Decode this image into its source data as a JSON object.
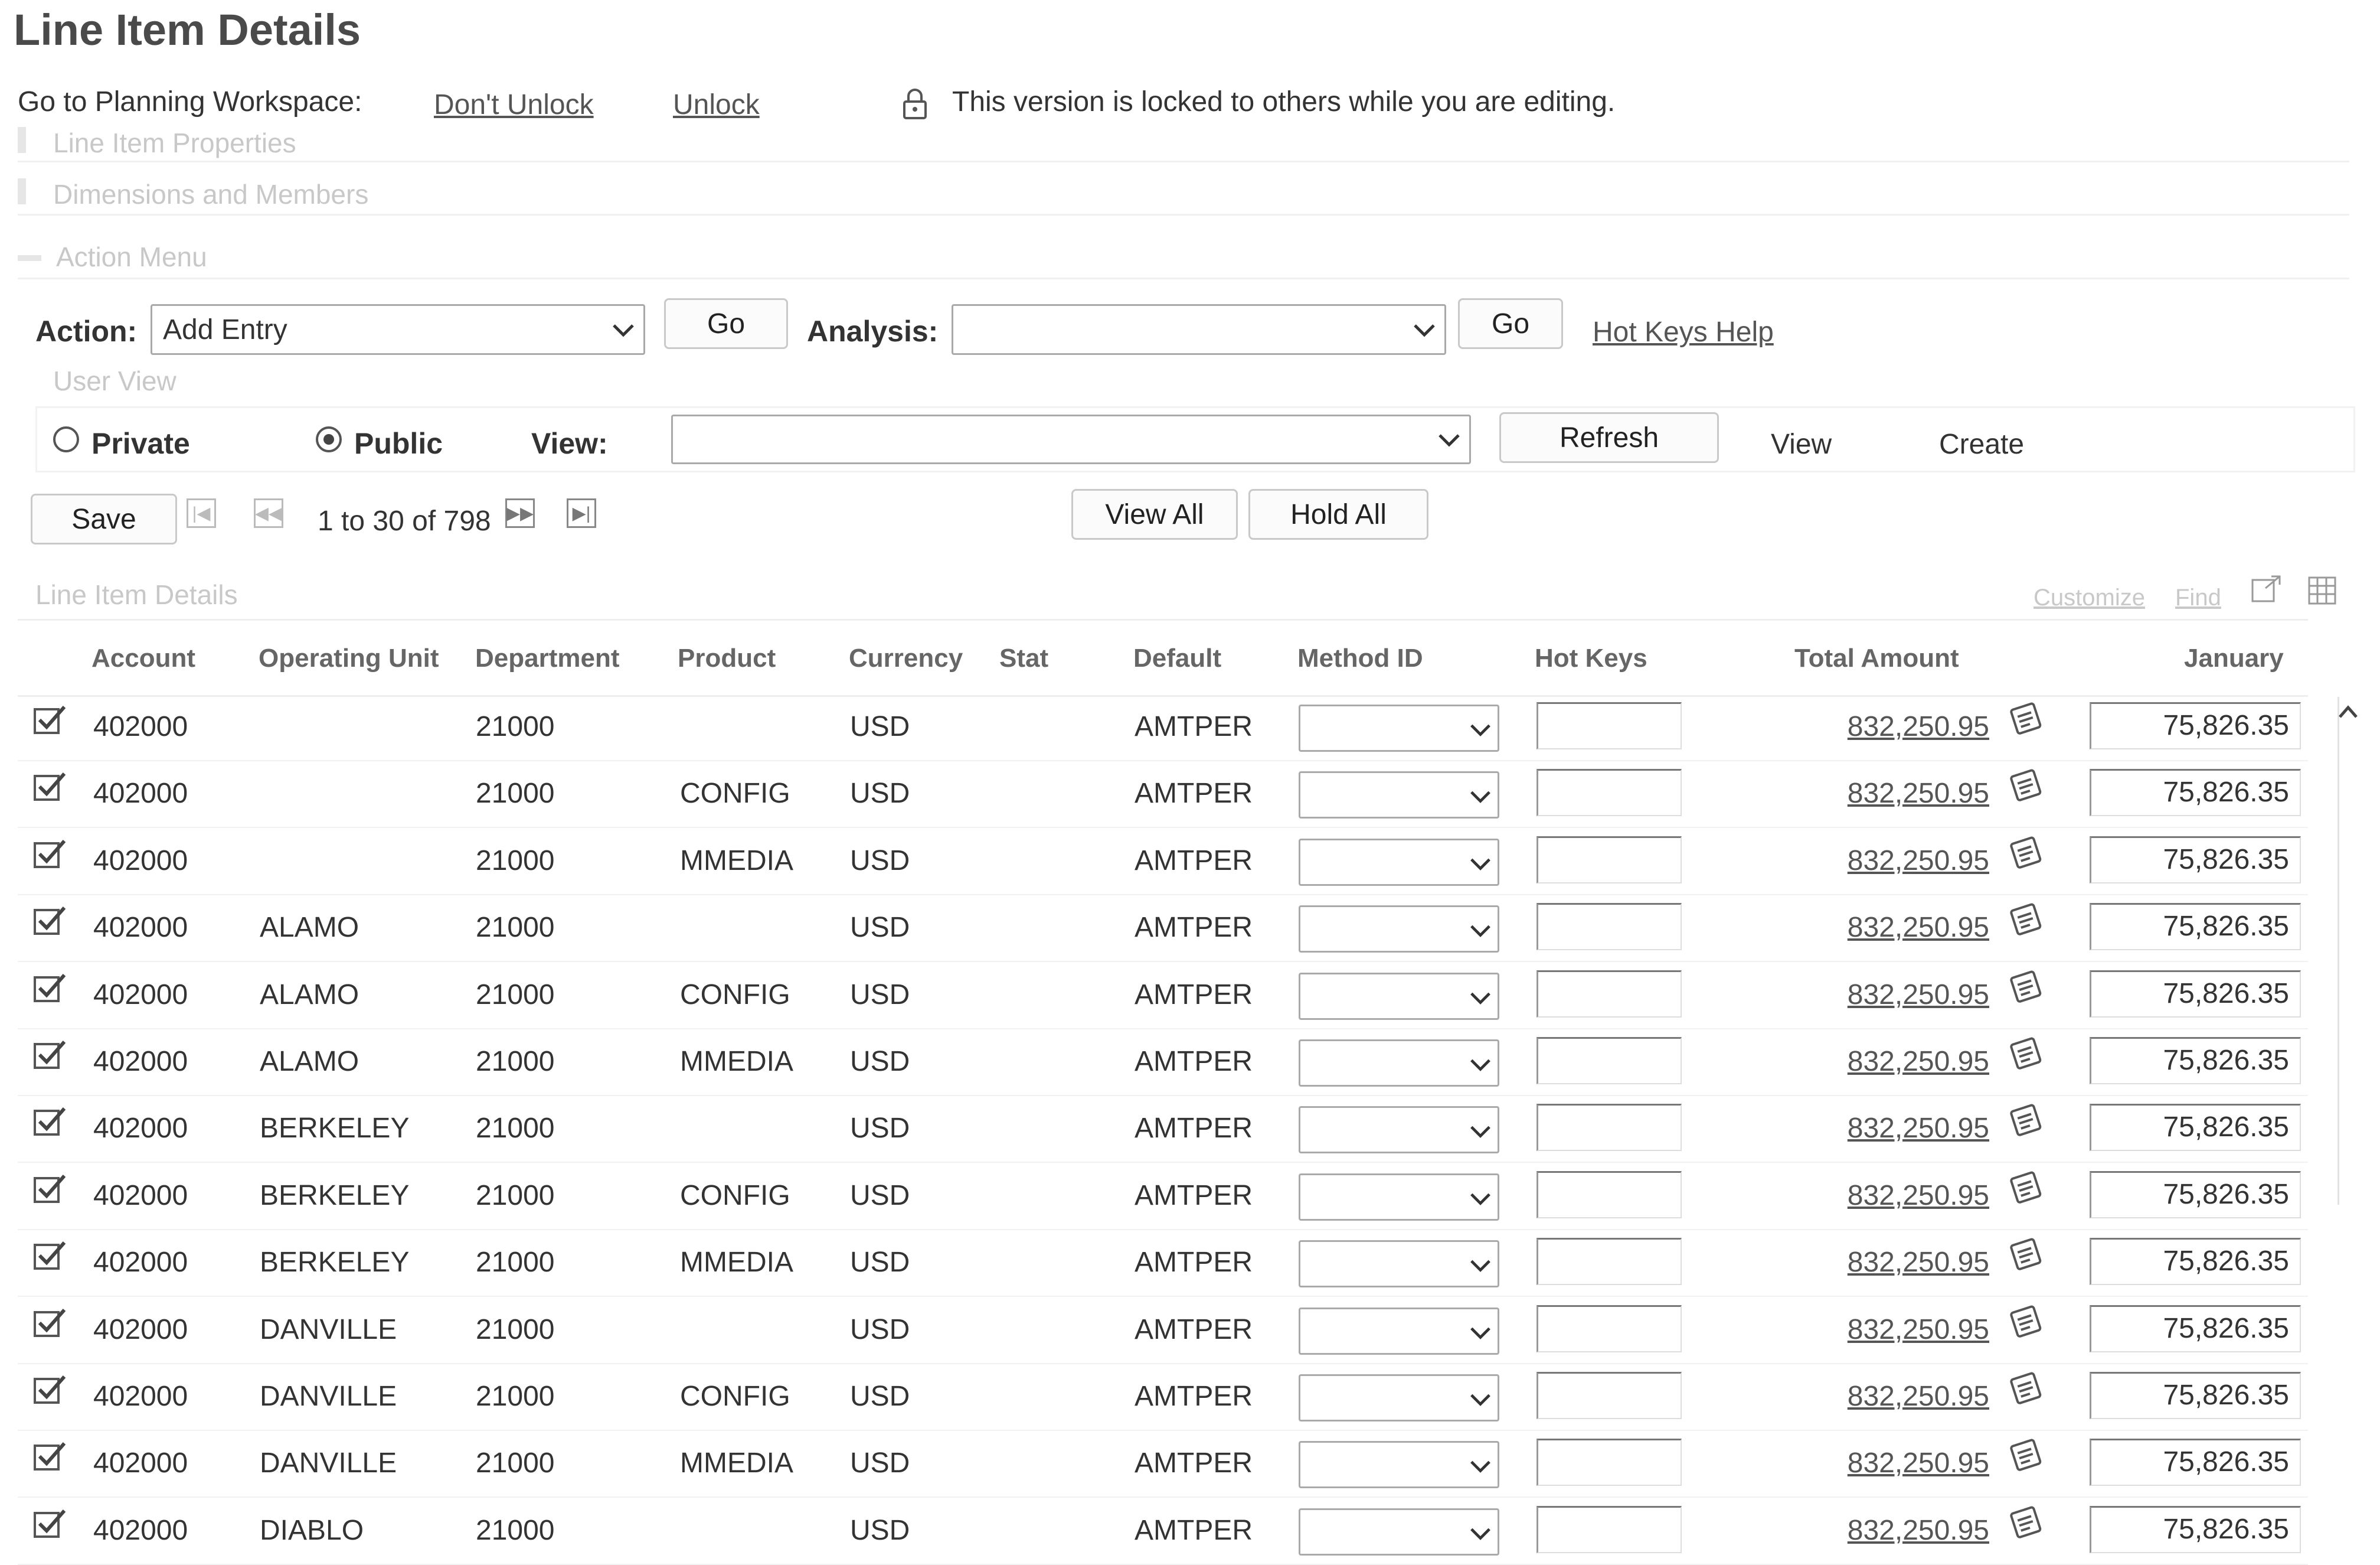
{
  "page_title": "Line Item Details",
  "workspace": {
    "label": "Go to Planning Workspace:",
    "dont_unlock": "Don't Unlock",
    "unlock": "Unlock",
    "lock_message": "This version is locked to others while you are editing."
  },
  "sections": {
    "line_item_properties": "Line Item Properties",
    "dimensions_members": "Dimensions and Members",
    "action_menu": "Action Menu",
    "user_view": "User View",
    "grid_title": "Line Item Details"
  },
  "action_menu": {
    "action_label": "Action:",
    "action_value": "Add Entry",
    "go_label": "Go",
    "analysis_label": "Analysis:",
    "analysis_value": "",
    "hotkeys_help": "Hot Keys Help"
  },
  "user_view": {
    "private_label": "Private",
    "public_label": "Public",
    "selected": "Public",
    "view_label": "View:",
    "view_value": "",
    "refresh_label": "Refresh",
    "view_link": "View",
    "create_link": "Create"
  },
  "toolbar": {
    "save_label": "Save",
    "pagination": "1 to 30 of 798",
    "view_all": "View All",
    "hold_all": "Hold All",
    "customize": "Customize",
    "find": "Find"
  },
  "grid": {
    "columns": [
      "Account",
      "Operating Unit",
      "Department",
      "Product",
      "Currency",
      "Stat",
      "Default",
      "Method ID",
      "Hot Keys",
      "Total Amount",
      "January"
    ],
    "rows": [
      {
        "account": "402000",
        "unit": "",
        "dept": "21000",
        "product": "",
        "currency": "USD",
        "stat": "",
        "default": "AMTPER",
        "method": "",
        "hotkeys": "",
        "total": "832,250.95",
        "january": "75,826.35",
        "checked": true
      },
      {
        "account": "402000",
        "unit": "",
        "dept": "21000",
        "product": "CONFIG",
        "currency": "USD",
        "stat": "",
        "default": "AMTPER",
        "method": "",
        "hotkeys": "",
        "total": "832,250.95",
        "january": "75,826.35",
        "checked": true
      },
      {
        "account": "402000",
        "unit": "",
        "dept": "21000",
        "product": "MMEDIA",
        "currency": "USD",
        "stat": "",
        "default": "AMTPER",
        "method": "",
        "hotkeys": "",
        "total": "832,250.95",
        "january": "75,826.35",
        "checked": true
      },
      {
        "account": "402000",
        "unit": "ALAMO",
        "dept": "21000",
        "product": "",
        "currency": "USD",
        "stat": "",
        "default": "AMTPER",
        "method": "",
        "hotkeys": "",
        "total": "832,250.95",
        "january": "75,826.35",
        "checked": true
      },
      {
        "account": "402000",
        "unit": "ALAMO",
        "dept": "21000",
        "product": "CONFIG",
        "currency": "USD",
        "stat": "",
        "default": "AMTPER",
        "method": "",
        "hotkeys": "",
        "total": "832,250.95",
        "january": "75,826.35",
        "checked": true
      },
      {
        "account": "402000",
        "unit": "ALAMO",
        "dept": "21000",
        "product": "MMEDIA",
        "currency": "USD",
        "stat": "",
        "default": "AMTPER",
        "method": "",
        "hotkeys": "",
        "total": "832,250.95",
        "january": "75,826.35",
        "checked": true
      },
      {
        "account": "402000",
        "unit": "BERKELEY",
        "dept": "21000",
        "product": "",
        "currency": "USD",
        "stat": "",
        "default": "AMTPER",
        "method": "",
        "hotkeys": "",
        "total": "832,250.95",
        "january": "75,826.35",
        "checked": true
      },
      {
        "account": "402000",
        "unit": "BERKELEY",
        "dept": "21000",
        "product": "CONFIG",
        "currency": "USD",
        "stat": "",
        "default": "AMTPER",
        "method": "",
        "hotkeys": "",
        "total": "832,250.95",
        "january": "75,826.35",
        "checked": true
      },
      {
        "account": "402000",
        "unit": "BERKELEY",
        "dept": "21000",
        "product": "MMEDIA",
        "currency": "USD",
        "stat": "",
        "default": "AMTPER",
        "method": "",
        "hotkeys": "",
        "total": "832,250.95",
        "january": "75,826.35",
        "checked": true
      },
      {
        "account": "402000",
        "unit": "DANVILLE",
        "dept": "21000",
        "product": "",
        "currency": "USD",
        "stat": "",
        "default": "AMTPER",
        "method": "",
        "hotkeys": "",
        "total": "832,250.95",
        "january": "75,826.35",
        "checked": true
      },
      {
        "account": "402000",
        "unit": "DANVILLE",
        "dept": "21000",
        "product": "CONFIG",
        "currency": "USD",
        "stat": "",
        "default": "AMTPER",
        "method": "",
        "hotkeys": "",
        "total": "832,250.95",
        "january": "75,826.35",
        "checked": true
      },
      {
        "account": "402000",
        "unit": "DANVILLE",
        "dept": "21000",
        "product": "MMEDIA",
        "currency": "USD",
        "stat": "",
        "default": "AMTPER",
        "method": "",
        "hotkeys": "",
        "total": "832,250.95",
        "january": "75,826.35",
        "checked": true
      },
      {
        "account": "402000",
        "unit": "DIABLO",
        "dept": "21000",
        "product": "",
        "currency": "USD",
        "stat": "",
        "default": "AMTPER",
        "method": "",
        "hotkeys": "",
        "total": "832,250.95",
        "january": "75,826.35",
        "checked": true
      }
    ]
  },
  "icons": {
    "lock": "lock-icon",
    "detail": "notepad-icon",
    "check": "checkbox-checked-icon",
    "first": "first-page-icon",
    "prev": "previous-page-icon",
    "next": "next-page-icon",
    "last": "last-page-icon",
    "zoom": "new-window-icon",
    "grid": "grid-download-icon"
  },
  "colors": {
    "text": "#333333",
    "link": "#555555",
    "faded": "#c8c8c8"
  }
}
